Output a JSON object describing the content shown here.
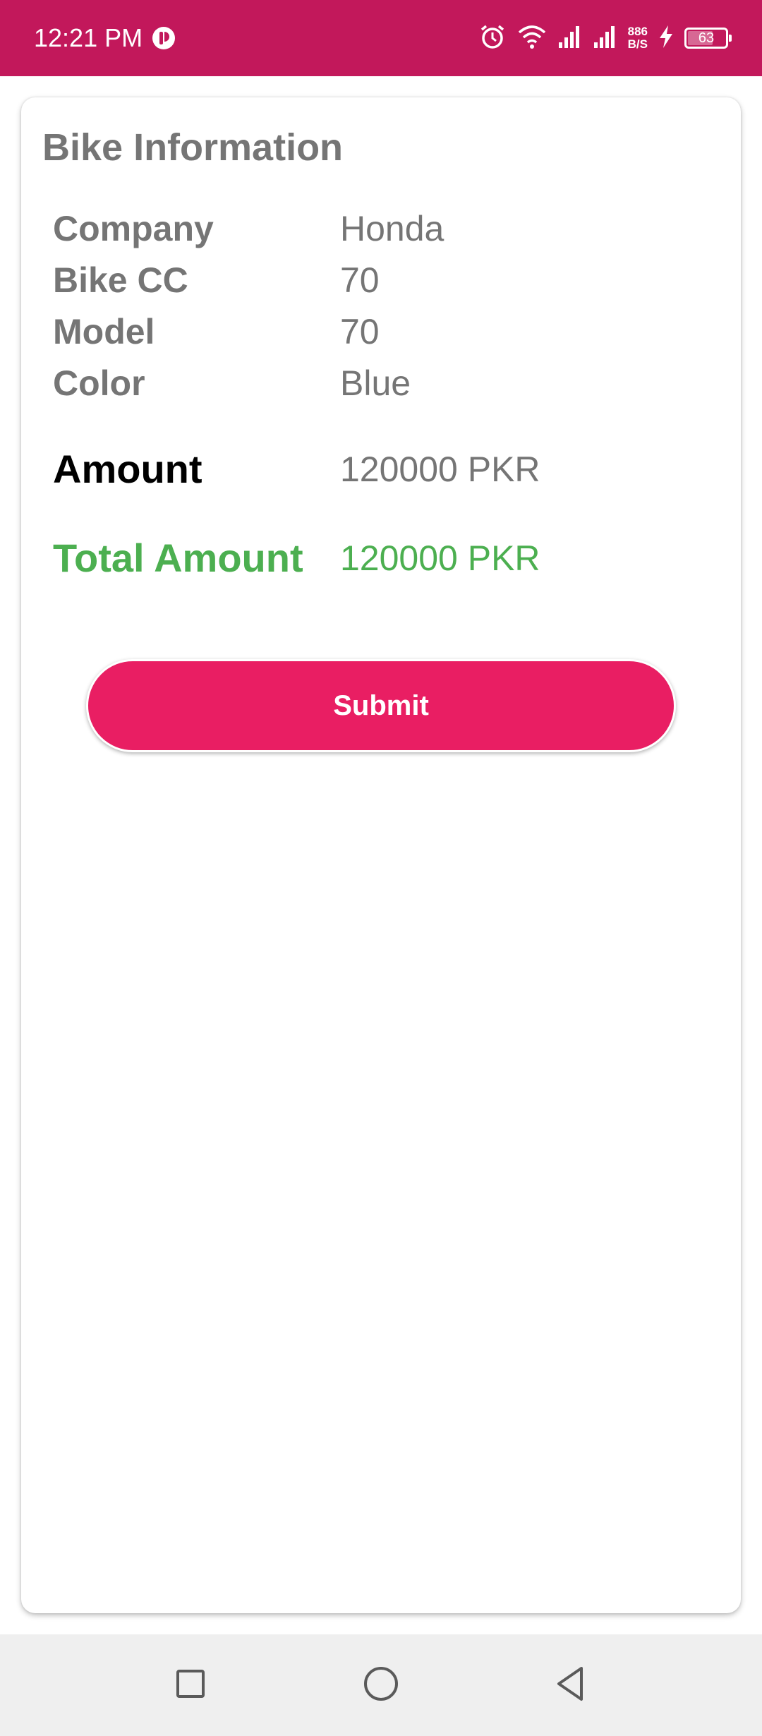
{
  "status_bar": {
    "time": "12:21 PM",
    "net_speed_value": "886",
    "net_speed_unit": "B/S",
    "battery_level": "63",
    "battery_fraction": 0.63,
    "icons": [
      "app-icon",
      "alarm-icon",
      "wifi-icon",
      "signal-icon",
      "signal-icon",
      "charging-icon",
      "battery-icon"
    ],
    "color": "#c2185b"
  },
  "card": {
    "title": "Bike Information",
    "rows": [
      {
        "label": "Company",
        "value": "Honda"
      },
      {
        "label": "Bike CC",
        "value": "70"
      },
      {
        "label": "Model",
        "value": "70"
      },
      {
        "label": "Color",
        "value": "Blue"
      }
    ],
    "amount": {
      "label": "Amount",
      "value": "120000 PKR"
    },
    "total": {
      "label": "Total Amount",
      "value": "120000 PKR",
      "color": "#4caf50"
    }
  },
  "submit_button": {
    "label": "Submit",
    "color": "#e91e63"
  },
  "nav_bar": {
    "icons": [
      "recents-square-icon",
      "home-circle-icon",
      "back-triangle-icon"
    ]
  }
}
